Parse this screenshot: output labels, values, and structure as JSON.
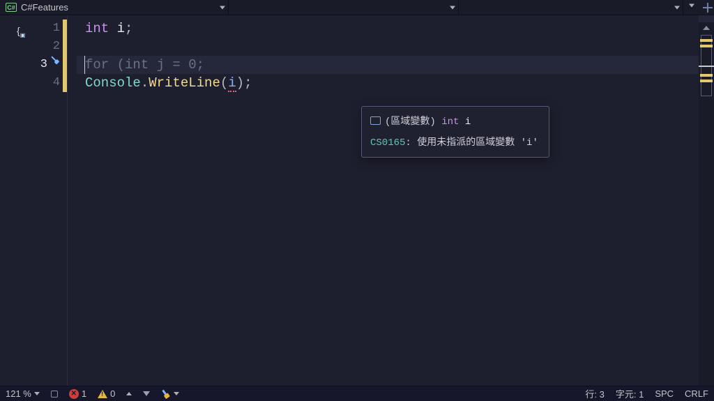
{
  "topbar": {
    "file_badge": "C#",
    "file_name": "C#Features"
  },
  "code": {
    "lines": [
      "1",
      "2",
      "3",
      "4"
    ],
    "current_line_index": 2,
    "l1_kw": "int",
    "l1_id": " i",
    "l1_end": ";",
    "l3_dim": "for (int j = 0;",
    "l4_cls": "Console",
    "l4_dot": ".",
    "l4_meth": "WriteLine",
    "l4_op": "(",
    "l4_arg": "i",
    "l4_cp": ")",
    "l4_end": ";"
  },
  "hover": {
    "kind_prefix": "(區域變數) ",
    "type": "int",
    "var": " i",
    "error_code": "CS0165",
    "error_sep": ": ",
    "error_msg": "使用未指派的區域變數 'i'"
  },
  "status": {
    "zoom": "121 %",
    "errors": "1",
    "warnings": "0",
    "line_label": "行: 3",
    "col_label": "字元: 1",
    "insert_mode": "SPC",
    "eol": "CRLF"
  }
}
